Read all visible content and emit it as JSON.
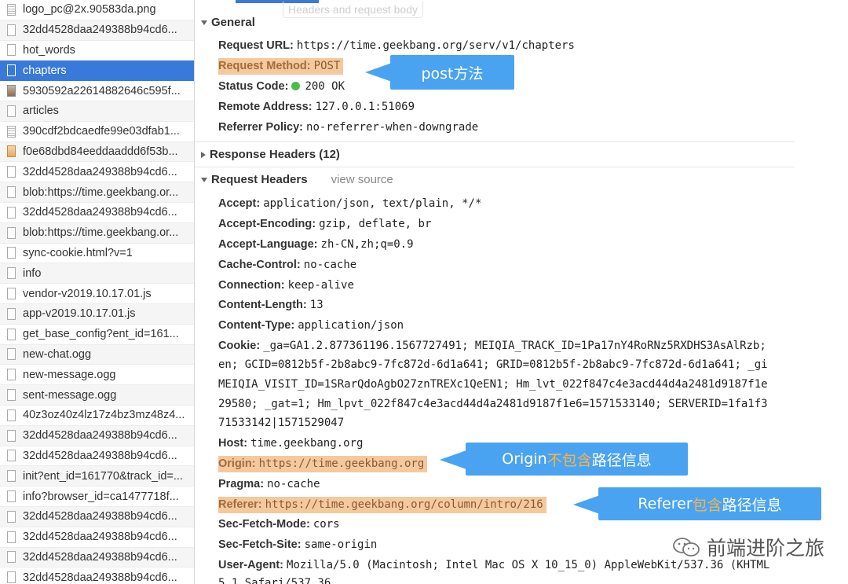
{
  "requests": [
    {
      "name": "logo_pc@2x.90583da.png",
      "icon": "doc",
      "selected": false
    },
    {
      "name": "32dd4528daa249388b94cd6...",
      "icon": "file",
      "selected": false
    },
    {
      "name": "hot_words",
      "icon": "file",
      "selected": false
    },
    {
      "name": "chapters",
      "icon": "file",
      "selected": true
    },
    {
      "name": "5930592a22614882646c595f...",
      "icon": "img",
      "selected": false
    },
    {
      "name": "articles",
      "icon": "file",
      "selected": false
    },
    {
      "name": "390cdf2bdcaedfe99e03dfab1...",
      "icon": "doc",
      "selected": false
    },
    {
      "name": "f0e68dbd84eeddaaddd6f53b...",
      "icon": "pic",
      "selected": false
    },
    {
      "name": "32dd4528daa249388b94cd6...",
      "icon": "file",
      "selected": false
    },
    {
      "name": "blob:https://time.geekbang.or...",
      "icon": "file",
      "selected": false
    },
    {
      "name": "32dd4528daa249388b94cd6...",
      "icon": "file",
      "selected": false
    },
    {
      "name": "blob:https://time.geekbang.or...",
      "icon": "file",
      "selected": false
    },
    {
      "name": "sync-cookie.html?v=1",
      "icon": "file",
      "selected": false
    },
    {
      "name": "info",
      "icon": "file",
      "selected": false
    },
    {
      "name": "vendor-v2019.10.17.01.js",
      "icon": "file",
      "selected": false
    },
    {
      "name": "app-v2019.10.17.01.js",
      "icon": "file",
      "selected": false
    },
    {
      "name": "get_base_config?ent_id=161...",
      "icon": "file",
      "selected": false
    },
    {
      "name": "new-chat.ogg",
      "icon": "file",
      "selected": false
    },
    {
      "name": "new-message.ogg",
      "icon": "file",
      "selected": false
    },
    {
      "name": "sent-message.ogg",
      "icon": "file",
      "selected": false
    },
    {
      "name": "40z3oz40z4lz17z4bz3mz48z4...",
      "icon": "file",
      "selected": false
    },
    {
      "name": "32dd4528daa249388b94cd6...",
      "icon": "file",
      "selected": false
    },
    {
      "name": "32dd4528daa249388b94cd6...",
      "icon": "file",
      "selected": false
    },
    {
      "name": "init?ent_id=161770&track_id=...",
      "icon": "file",
      "selected": false
    },
    {
      "name": "info?browser_id=ca1477718f...",
      "icon": "file",
      "selected": false
    },
    {
      "name": "32dd4528daa249388b94cd6...",
      "icon": "file",
      "selected": false
    },
    {
      "name": "32dd4528daa249388b94cd6...",
      "icon": "file",
      "selected": false
    },
    {
      "name": "32dd4528daa249388b94cd6...",
      "icon": "file",
      "selected": false
    },
    {
      "name": "32dd4528daa249388b94cd6...",
      "icon": "file",
      "selected": false
    }
  ],
  "ghost_tab": "Headers and request body",
  "general": {
    "title": "General",
    "request_url_key": "Request URL:",
    "request_url_val": "https://time.geekbang.org/serv/v1/chapters",
    "request_method_key": "Request Method:",
    "request_method_val": "POST",
    "status_code_key": "Status Code:",
    "status_code_val": "200 OK",
    "remote_address_key": "Remote Address:",
    "remote_address_val": "127.0.0.1:51069",
    "referrer_policy_key": "Referrer Policy:",
    "referrer_policy_val": "no-referrer-when-downgrade"
  },
  "response_headers": {
    "title": "Response Headers (12)"
  },
  "request_headers": {
    "title": "Request Headers",
    "view_source": "view source",
    "rows": {
      "accept": {
        "key": "Accept:",
        "val": "application/json, text/plain, */*"
      },
      "accept_encoding": {
        "key": "Accept-Encoding:",
        "val": "gzip, deflate, br"
      },
      "accept_language": {
        "key": "Accept-Language:",
        "val": "zh-CN,zh;q=0.9"
      },
      "cache_control": {
        "key": "Cache-Control:",
        "val": "no-cache"
      },
      "connection": {
        "key": "Connection:",
        "val": "keep-alive"
      },
      "content_length": {
        "key": "Content-Length:",
        "val": "13"
      },
      "content_type": {
        "key": "Content-Type:",
        "val": "application/json"
      },
      "cookie": {
        "key": "Cookie:",
        "val": "_ga=GA1.2.877361196.1567727491; MEIQIA_TRACK_ID=1Pa17nY4RoRNz5RXDHS3AsAlRzb;"
      },
      "host": {
        "key": "Host:",
        "val": "time.geekbang.org"
      },
      "origin": {
        "key": "Origin:",
        "val": "https://time.geekbang.org"
      },
      "pragma": {
        "key": "Pragma:",
        "val": "no-cache"
      },
      "referer": {
        "key": "Referer:",
        "val": "https://time.geekbang.org/column/intro/216"
      },
      "sec_fetch_mode": {
        "key": "Sec-Fetch-Mode:",
        "val": "cors"
      },
      "sec_fetch_site": {
        "key": "Sec-Fetch-Site:",
        "val": "same-origin"
      },
      "user_agent": {
        "key": "User-Agent:",
        "val": "Mozilla/5.0 (Macintosh; Intel Mac OS X 10_15_0) AppleWebKit/537.36 (KHTML"
      }
    },
    "cookie_cont": [
      "en; GCID=0812b5f-2b8abc9-7fc872d-6d1a641; GRID=0812b5f-2b8abc9-7fc872d-6d1a641; _gi",
      "MEIQIA_VISIT_ID=1SRarQdoAgbO27znTREXc1QeEN1; Hm_lvt_022f847c4e3acd44d4a2481d9187f1e",
      "29580; _gat=1; Hm_lpvt_022f847c4e3acd44d4a2481d9187f1e6=1571533140; SERVERID=1fa1f3",
      "71533142|1571529047"
    ],
    "user_agent_cont": "5 1 Safari/537 36"
  },
  "callouts": {
    "post": {
      "text_white": "post方法",
      "text_orange": "",
      "text_white2": ""
    },
    "origin": {
      "text_white": "Origin",
      "text_orange": "不包含",
      "text_white2": "路径信息"
    },
    "referer": {
      "text_white": "Referer",
      "text_orange": "包含",
      "text_white2": "路径信息"
    }
  },
  "watermark": {
    "text": "前端进阶之旅",
    "icon": "wechat-icon"
  },
  "colors": {
    "selected_bg": "#3879d9",
    "highlight": "#f3c99d",
    "callout": "#4aa3f0",
    "callout_accent": "#f6b44a",
    "status_ok": "#4dbb4d"
  }
}
